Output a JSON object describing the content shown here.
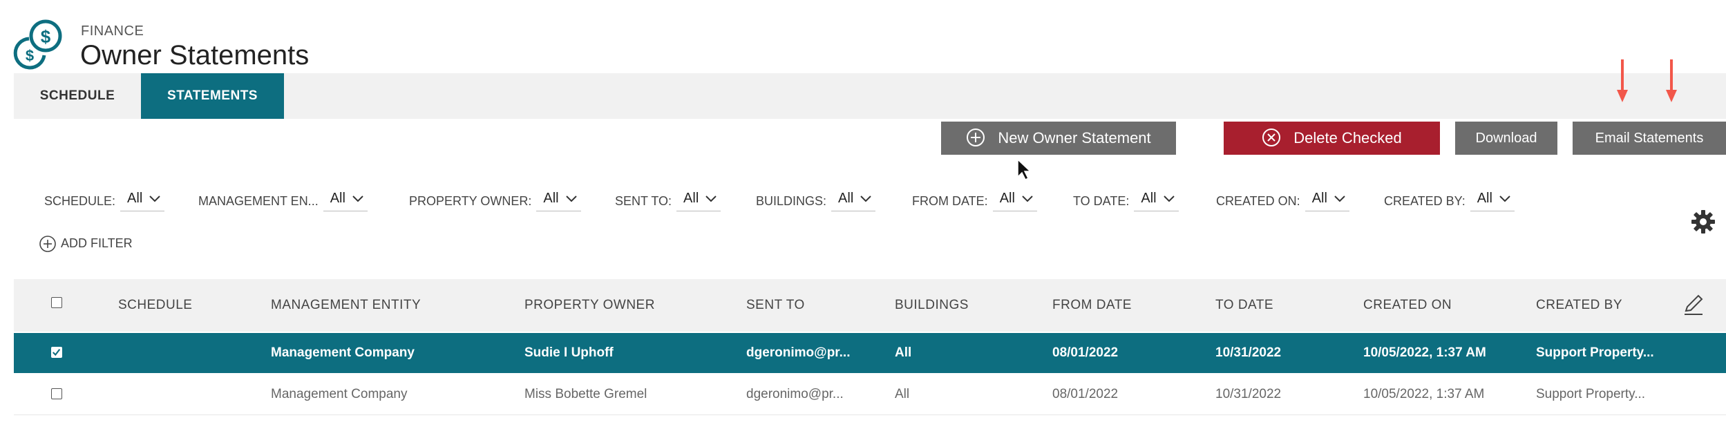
{
  "header": {
    "section": "FINANCE",
    "title": "Owner Statements"
  },
  "tabs": [
    {
      "label": "SCHEDULE",
      "active": false
    },
    {
      "label": "STATEMENTS",
      "active": true
    }
  ],
  "actions": {
    "new_statement": "New Owner Statement",
    "delete_checked": "Delete Checked",
    "download": "Download",
    "email_statements": "Email Statements"
  },
  "filters": [
    {
      "label": "SCHEDULE:",
      "value": "All"
    },
    {
      "label": "MANAGEMENT EN...",
      "value": "All"
    },
    {
      "label": "PROPERTY OWNER:",
      "value": "All"
    },
    {
      "label": "SENT TO:",
      "value": "All"
    },
    {
      "label": "BUILDINGS:",
      "value": "All"
    },
    {
      "label": "FROM DATE:",
      "value": "All"
    },
    {
      "label": "TO DATE:",
      "value": "All"
    },
    {
      "label": "CREATED ON:",
      "value": "All"
    },
    {
      "label": "CREATED BY:",
      "value": "All"
    }
  ],
  "add_filter": "ADD FILTER",
  "table": {
    "columns": [
      "SCHEDULE",
      "MANAGEMENT ENTITY",
      "PROPERTY OWNER",
      "SENT TO",
      "BUILDINGS",
      "FROM DATE",
      "TO DATE",
      "CREATED ON",
      "CREATED BY"
    ],
    "rows": [
      {
        "checked": true,
        "cells": [
          "",
          "Management Company",
          "Sudie I Uphoff",
          "dgeronimo@pr...",
          "All",
          "08/01/2022",
          "10/31/2022",
          "10/05/2022, 1:37 AM",
          "Support Property..."
        ]
      },
      {
        "checked": false,
        "cells": [
          "",
          "Management Company",
          "Miss Bobette Gremel",
          "dgeronimo@pr...",
          "All",
          "08/01/2022",
          "10/31/2022",
          "10/05/2022, 1:37 AM",
          "Support Property..."
        ]
      }
    ]
  },
  "colors": {
    "accent": "#0d6e80",
    "danger": "#a81f2e",
    "button_gray": "#6d6d6d",
    "annotation_arrow": "#f2574a"
  },
  "icons": {
    "logo": "dollar-coins-icon",
    "add": "plus-circle-icon",
    "delete": "x-circle-icon",
    "settings": "gear-icon",
    "edit": "pencil-icon"
  }
}
